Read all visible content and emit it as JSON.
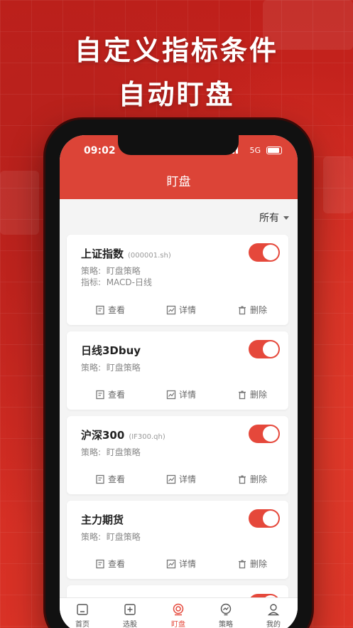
{
  "headline": {
    "line1": "自定义指标条件",
    "line2": "自动盯盘"
  },
  "status": {
    "time": "09:02",
    "network": "5G"
  },
  "navbar": {
    "title": "盯盘"
  },
  "filter": {
    "label": "所有"
  },
  "labels": {
    "strategy": "策略:",
    "indicator": "指标:"
  },
  "actions": {
    "view": "查看",
    "detail": "详情",
    "delete": "删除"
  },
  "cards": [
    {
      "name": "上证指数",
      "code": "(000001.sh)",
      "strategy": "盯盘策略",
      "indicator": "MACD-日线",
      "enabled": true
    },
    {
      "name": "日线3Dbuy",
      "code": "",
      "strategy": "盯盘策略",
      "enabled": true
    },
    {
      "name": "沪深300",
      "code": "(IF300.qh)",
      "strategy": "盯盘策略",
      "enabled": true
    },
    {
      "name": "主力期货",
      "code": "",
      "strategy": "盯盘策略",
      "enabled": true
    }
  ],
  "tabs": [
    {
      "label": "首页",
      "icon": "home-icon"
    },
    {
      "label": "选股",
      "icon": "stock-pick-icon"
    },
    {
      "label": "盯盘",
      "icon": "watch-icon",
      "active": true
    },
    {
      "label": "策略",
      "icon": "strategy-icon"
    },
    {
      "label": "我的",
      "icon": "profile-icon"
    }
  ],
  "colors": {
    "brand": "#dc4437",
    "toggle": "#e5483b",
    "background": "#c8201c"
  }
}
